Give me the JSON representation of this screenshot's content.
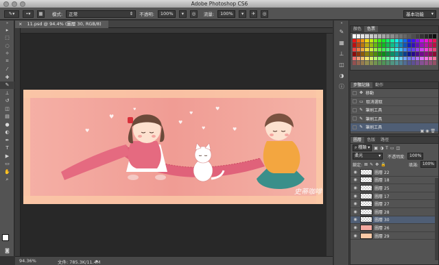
{
  "app": {
    "title": "Adobe Photoshop CS6",
    "workspace": "基本功能"
  },
  "options_bar": {
    "mode_label": "模式:",
    "mode_value": "正常",
    "opacity_label": "不透明:",
    "opacity_value": "100%",
    "flow_label": "流量:",
    "flow_value": "100%"
  },
  "document": {
    "tab": "11.psd @ 94.4% (圖層 30, RGB/8)"
  },
  "status": {
    "zoom": "94.36%",
    "file": "文件: 785.3K/11.4M"
  },
  "artwork": {
    "signature": "史蒂咖啡 stillllsign"
  },
  "swatch_panel": {
    "tabs": [
      "顏色",
      "色票"
    ],
    "active_tab": 1
  },
  "history_panel": {
    "tabs": [
      "步驟記錄",
      "動作"
    ],
    "active_tab": 0,
    "items": [
      "移動",
      "取消選取",
      "筆刷工具",
      "筆刷工具",
      "筆刷工具"
    ],
    "selected": 4
  },
  "layers_panel": {
    "tabs": [
      "圖層",
      "色版",
      "路徑"
    ],
    "active_tab": 0,
    "kind_filter": "種類",
    "blend_mode": "柔光",
    "opacity_label": "不透明度:",
    "opacity_value": "100%",
    "lock_label": "鎖定:",
    "fill_label": "填滿:",
    "fill_value": "100%",
    "layers": [
      "圖層 22",
      "圖層 18",
      "圖層 25",
      "圖層 17",
      "圖層 27",
      "圖層 28",
      "圖層 30",
      "圖層 26",
      "圖層 29"
    ],
    "selected": 6
  }
}
